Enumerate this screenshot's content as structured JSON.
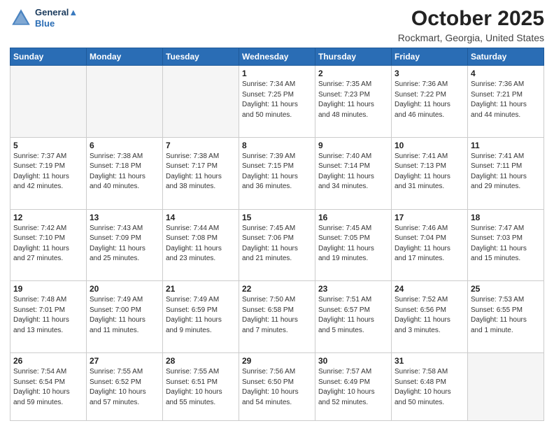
{
  "header": {
    "logo_line1": "General",
    "logo_line2": "Blue",
    "month": "October 2025",
    "location": "Rockmart, Georgia, United States"
  },
  "weekdays": [
    "Sunday",
    "Monday",
    "Tuesday",
    "Wednesday",
    "Thursday",
    "Friday",
    "Saturday"
  ],
  "weeks": [
    [
      {
        "day": "",
        "info": ""
      },
      {
        "day": "",
        "info": ""
      },
      {
        "day": "",
        "info": ""
      },
      {
        "day": "1",
        "info": "Sunrise: 7:34 AM\nSunset: 7:25 PM\nDaylight: 11 hours\nand 50 minutes."
      },
      {
        "day": "2",
        "info": "Sunrise: 7:35 AM\nSunset: 7:23 PM\nDaylight: 11 hours\nand 48 minutes."
      },
      {
        "day": "3",
        "info": "Sunrise: 7:36 AM\nSunset: 7:22 PM\nDaylight: 11 hours\nand 46 minutes."
      },
      {
        "day": "4",
        "info": "Sunrise: 7:36 AM\nSunset: 7:21 PM\nDaylight: 11 hours\nand 44 minutes."
      }
    ],
    [
      {
        "day": "5",
        "info": "Sunrise: 7:37 AM\nSunset: 7:19 PM\nDaylight: 11 hours\nand 42 minutes."
      },
      {
        "day": "6",
        "info": "Sunrise: 7:38 AM\nSunset: 7:18 PM\nDaylight: 11 hours\nand 40 minutes."
      },
      {
        "day": "7",
        "info": "Sunrise: 7:38 AM\nSunset: 7:17 PM\nDaylight: 11 hours\nand 38 minutes."
      },
      {
        "day": "8",
        "info": "Sunrise: 7:39 AM\nSunset: 7:15 PM\nDaylight: 11 hours\nand 36 minutes."
      },
      {
        "day": "9",
        "info": "Sunrise: 7:40 AM\nSunset: 7:14 PM\nDaylight: 11 hours\nand 34 minutes."
      },
      {
        "day": "10",
        "info": "Sunrise: 7:41 AM\nSunset: 7:13 PM\nDaylight: 11 hours\nand 31 minutes."
      },
      {
        "day": "11",
        "info": "Sunrise: 7:41 AM\nSunset: 7:11 PM\nDaylight: 11 hours\nand 29 minutes."
      }
    ],
    [
      {
        "day": "12",
        "info": "Sunrise: 7:42 AM\nSunset: 7:10 PM\nDaylight: 11 hours\nand 27 minutes."
      },
      {
        "day": "13",
        "info": "Sunrise: 7:43 AM\nSunset: 7:09 PM\nDaylight: 11 hours\nand 25 minutes."
      },
      {
        "day": "14",
        "info": "Sunrise: 7:44 AM\nSunset: 7:08 PM\nDaylight: 11 hours\nand 23 minutes."
      },
      {
        "day": "15",
        "info": "Sunrise: 7:45 AM\nSunset: 7:06 PM\nDaylight: 11 hours\nand 21 minutes."
      },
      {
        "day": "16",
        "info": "Sunrise: 7:45 AM\nSunset: 7:05 PM\nDaylight: 11 hours\nand 19 minutes."
      },
      {
        "day": "17",
        "info": "Sunrise: 7:46 AM\nSunset: 7:04 PM\nDaylight: 11 hours\nand 17 minutes."
      },
      {
        "day": "18",
        "info": "Sunrise: 7:47 AM\nSunset: 7:03 PM\nDaylight: 11 hours\nand 15 minutes."
      }
    ],
    [
      {
        "day": "19",
        "info": "Sunrise: 7:48 AM\nSunset: 7:01 PM\nDaylight: 11 hours\nand 13 minutes."
      },
      {
        "day": "20",
        "info": "Sunrise: 7:49 AM\nSunset: 7:00 PM\nDaylight: 11 hours\nand 11 minutes."
      },
      {
        "day": "21",
        "info": "Sunrise: 7:49 AM\nSunset: 6:59 PM\nDaylight: 11 hours\nand 9 minutes."
      },
      {
        "day": "22",
        "info": "Sunrise: 7:50 AM\nSunset: 6:58 PM\nDaylight: 11 hours\nand 7 minutes."
      },
      {
        "day": "23",
        "info": "Sunrise: 7:51 AM\nSunset: 6:57 PM\nDaylight: 11 hours\nand 5 minutes."
      },
      {
        "day": "24",
        "info": "Sunrise: 7:52 AM\nSunset: 6:56 PM\nDaylight: 11 hours\nand 3 minutes."
      },
      {
        "day": "25",
        "info": "Sunrise: 7:53 AM\nSunset: 6:55 PM\nDaylight: 11 hours\nand 1 minute."
      }
    ],
    [
      {
        "day": "26",
        "info": "Sunrise: 7:54 AM\nSunset: 6:54 PM\nDaylight: 10 hours\nand 59 minutes."
      },
      {
        "day": "27",
        "info": "Sunrise: 7:55 AM\nSunset: 6:52 PM\nDaylight: 10 hours\nand 57 minutes."
      },
      {
        "day": "28",
        "info": "Sunrise: 7:55 AM\nSunset: 6:51 PM\nDaylight: 10 hours\nand 55 minutes."
      },
      {
        "day": "29",
        "info": "Sunrise: 7:56 AM\nSunset: 6:50 PM\nDaylight: 10 hours\nand 54 minutes."
      },
      {
        "day": "30",
        "info": "Sunrise: 7:57 AM\nSunset: 6:49 PM\nDaylight: 10 hours\nand 52 minutes."
      },
      {
        "day": "31",
        "info": "Sunrise: 7:58 AM\nSunset: 6:48 PM\nDaylight: 10 hours\nand 50 minutes."
      },
      {
        "day": "",
        "info": ""
      }
    ]
  ]
}
